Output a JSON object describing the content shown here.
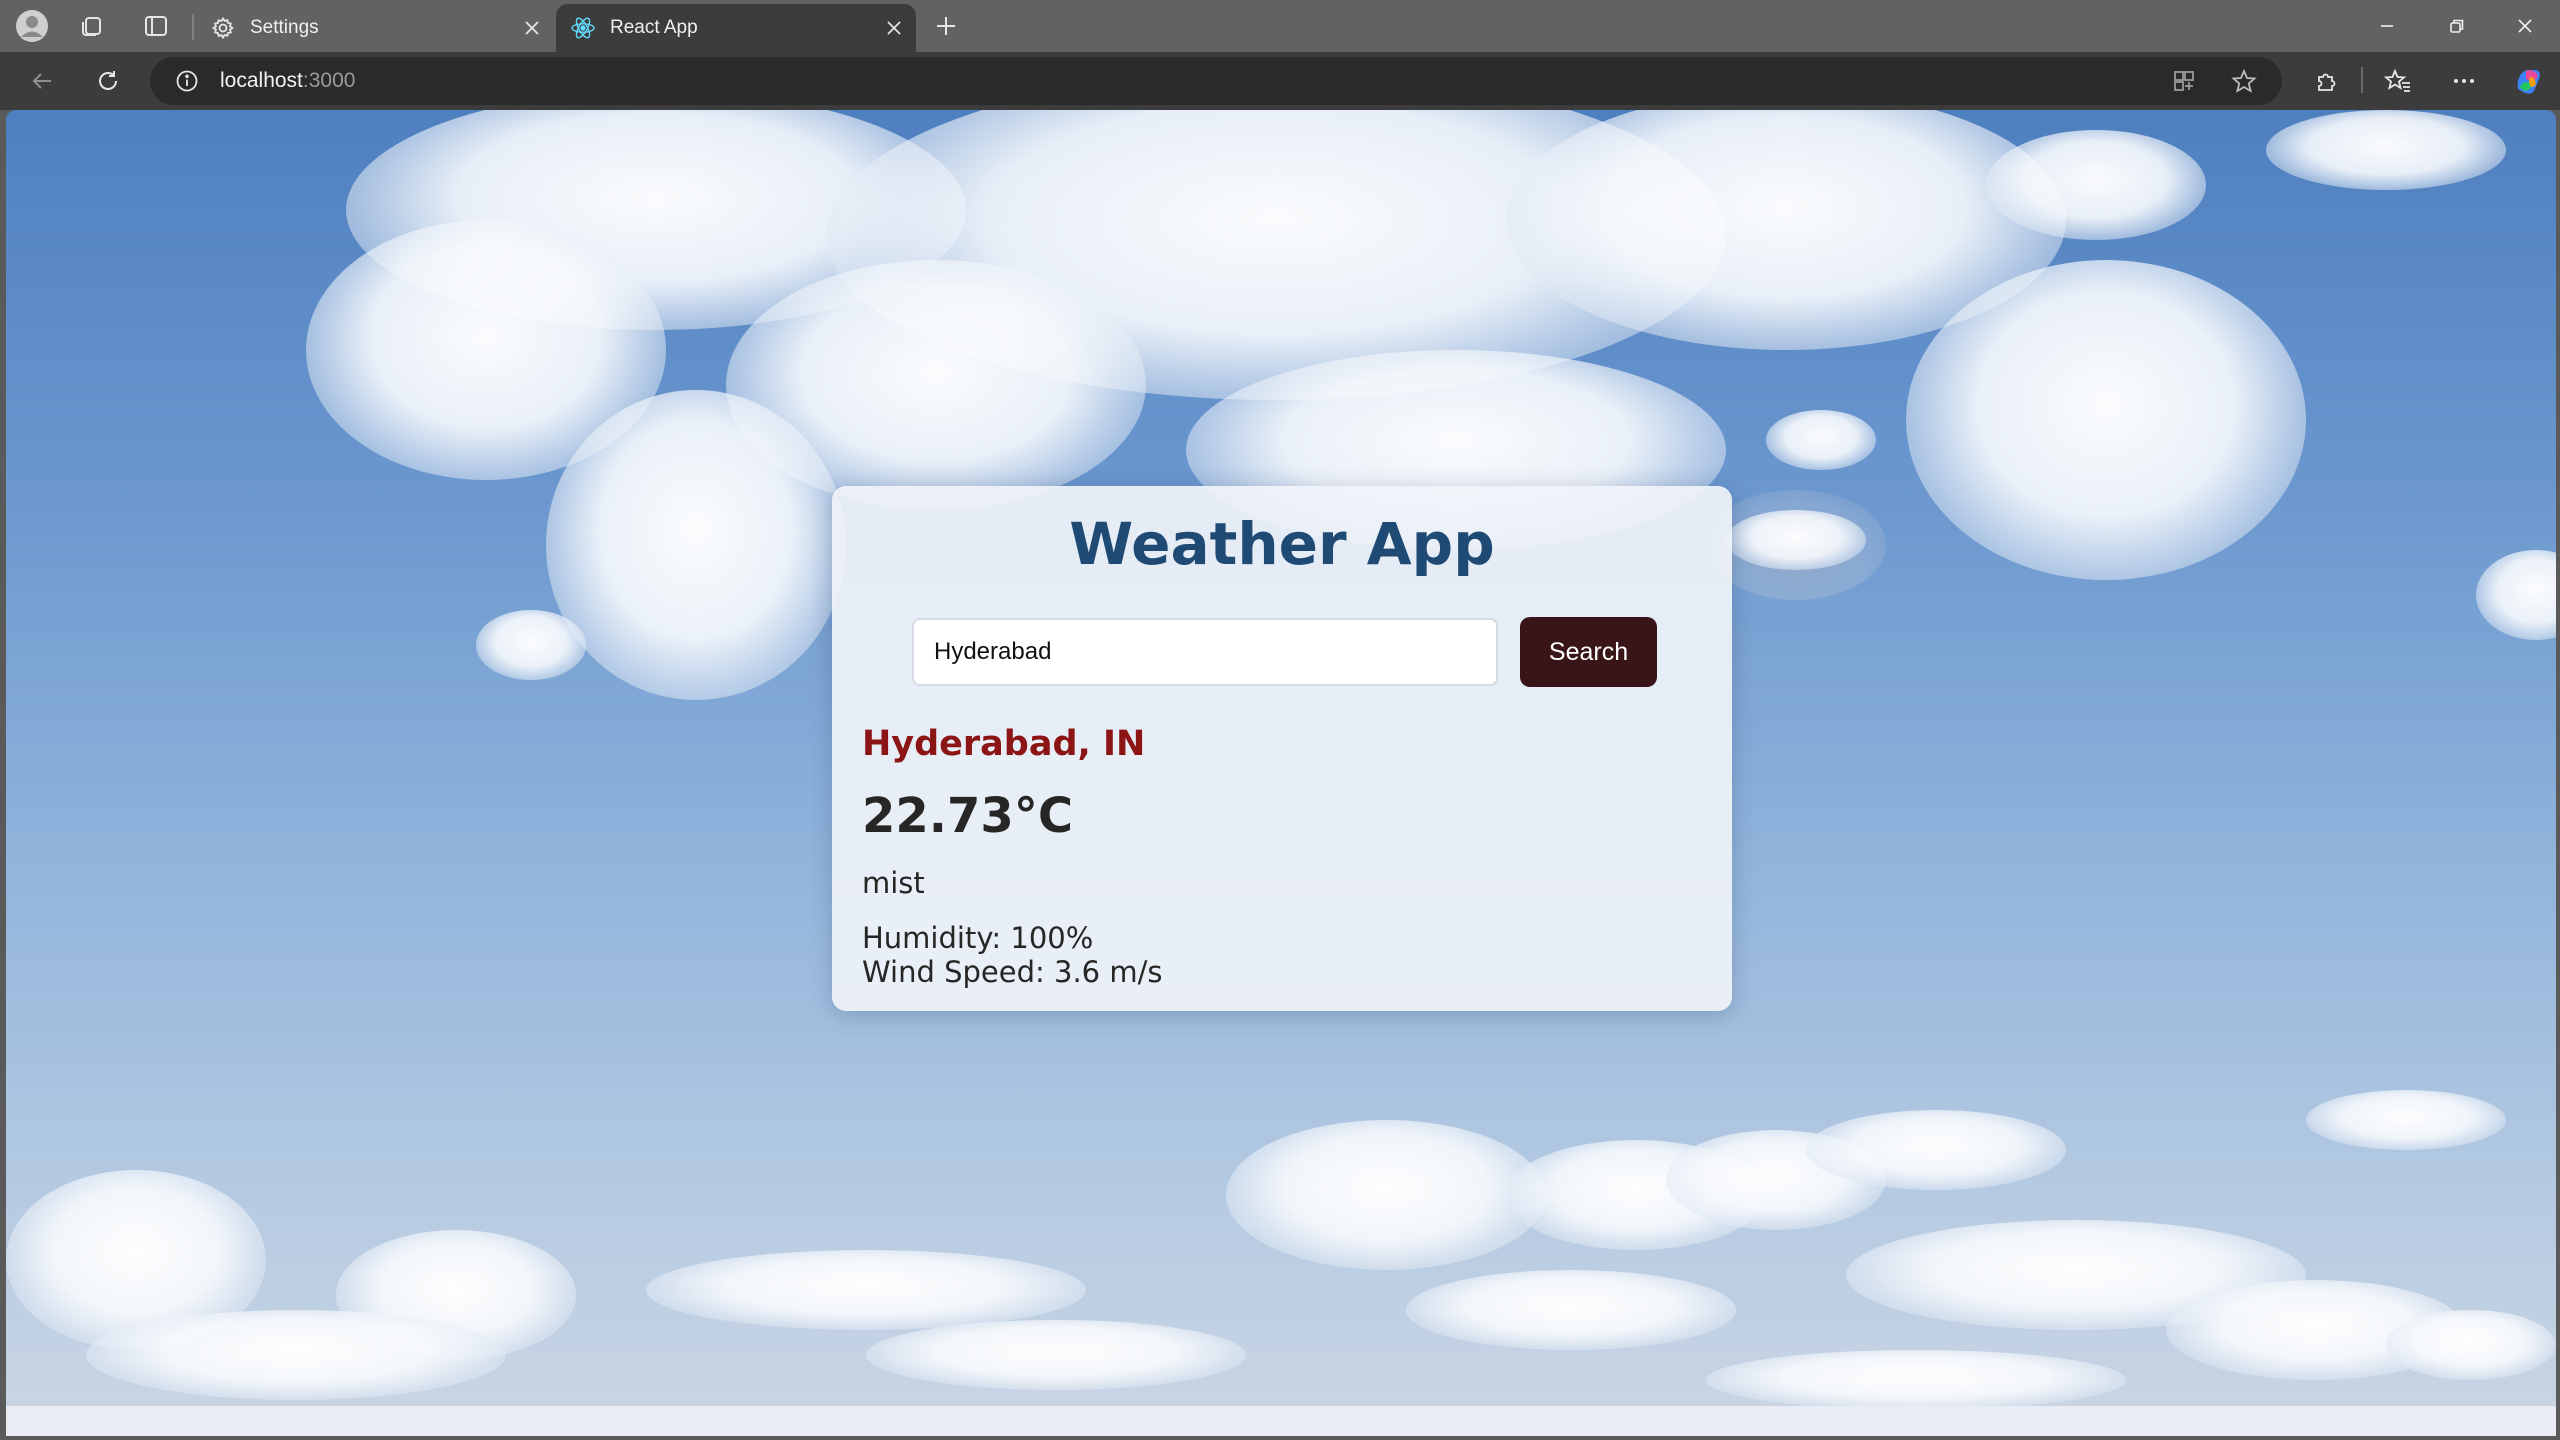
{
  "browser": {
    "tabs": [
      {
        "title": "Settings",
        "icon": "gear-icon",
        "active": false
      },
      {
        "title": "React App",
        "icon": "react-icon",
        "active": true
      }
    ],
    "address": {
      "host": "localhost",
      "port": ":3000"
    }
  },
  "app": {
    "title": "Weather App",
    "search": {
      "value": "Hyderabad",
      "button_label": "Search"
    },
    "result": {
      "location": "Hyderabad, IN",
      "temperature": "22.73°C",
      "description": "mist",
      "humidity": "Humidity: 100%",
      "wind": "Wind Speed: 3.6 m/s"
    }
  },
  "colors": {
    "title": "#1f4a73",
    "location": "#8b1414",
    "button": "#3a1518"
  }
}
